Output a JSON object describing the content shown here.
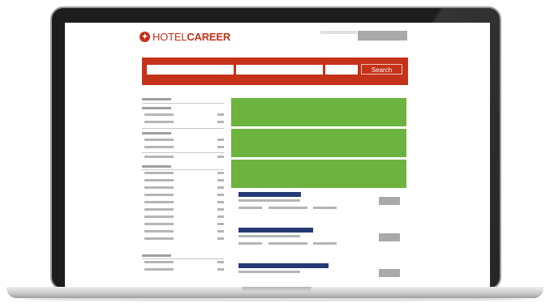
{
  "header": {
    "logo_prefix": "HOTEL",
    "logo_suffix": "CAREER",
    "logo_icon": "hotelcareer-logo-icon"
  },
  "search": {
    "button_label": "Search"
  },
  "colors": {
    "brand": "#c4321a",
    "banner": "#6db33f",
    "job_title": "#253a75",
    "bezel": "#1d1d1d"
  }
}
